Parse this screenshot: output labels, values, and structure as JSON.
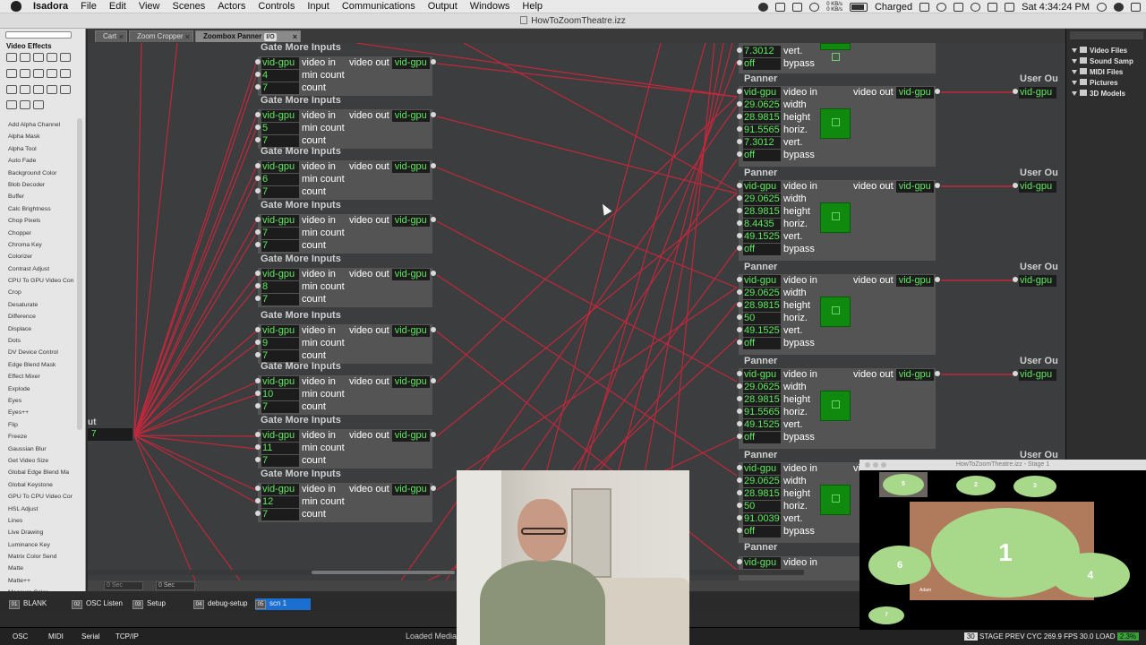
{
  "menubar": {
    "app": "Isadora",
    "items": [
      "File",
      "Edit",
      "View",
      "Scenes",
      "Actors",
      "Controls",
      "Input",
      "Communications",
      "Output",
      "Windows",
      "Help"
    ],
    "battery": "Charged",
    "clock": "Sat 4:34:24 PM",
    "net_up": "0 KB/s",
    "net_down": "0 KB/s"
  },
  "window": {
    "title": "HowToZoomTheatre.izz"
  },
  "left_panel": {
    "title": "Video Effects",
    "items": [
      "Add Alpha Channel",
      "Alpha Mask",
      "Alpha Tool",
      "Auto Fade",
      "Background Color",
      "Blob Decoder",
      "Buffer",
      "Calc Brightness",
      "Chop Pixels",
      "Chopper",
      "Chroma Key",
      "Colorizer",
      "Contrast Adjust",
      "CPU To GPU Video Con",
      "Crop",
      "Desaturate",
      "Difference",
      "Displace",
      "Dots",
      "DV Device Control",
      "Edge Blend Mask",
      "Effect Mixer",
      "Explode",
      "Eyes",
      "Eyes++",
      "Flip",
      "Freeze",
      "Gaussian Blur",
      "Get Video Size",
      "Global Edge Blend Ma",
      "Global Keystone",
      "GPU To CPU Video Cor",
      "HSL Adjust",
      "Lines",
      "Live Drawing",
      "Luminance Key",
      "Matrix Color Send",
      "Matte",
      "Matte++",
      "Measure Color"
    ]
  },
  "tabs": [
    {
      "label": "Cart",
      "active": false
    },
    {
      "label": "Zoom Cropper",
      "active": false
    },
    {
      "label": "Zoombox Panner",
      "active": true,
      "badge": "I/O"
    }
  ],
  "gates": [
    {
      "title": "Gate More Inputs",
      "input": "vid-gpu",
      "min_count": "4",
      "count": "7",
      "label_in": "video in",
      "label_out": "video out",
      "output": "vid-gpu",
      "label_min": "min count",
      "label_count": "count"
    },
    {
      "title": "Gate More Inputs",
      "input": "vid-gpu",
      "min_count": "5",
      "count": "7",
      "label_in": "video in",
      "label_out": "video out",
      "output": "vid-gpu",
      "label_min": "min count",
      "label_count": "count"
    },
    {
      "title": "Gate More Inputs",
      "input": "vid-gpu",
      "min_count": "6",
      "count": "7",
      "label_in": "video in",
      "label_out": "video out",
      "output": "vid-gpu",
      "label_min": "min count",
      "label_count": "count"
    },
    {
      "title": "Gate More Inputs",
      "input": "vid-gpu",
      "min_count": "7",
      "count": "7",
      "label_in": "video in",
      "label_out": "video out",
      "output": "vid-gpu",
      "label_min": "min count",
      "label_count": "count"
    },
    {
      "title": "Gate More Inputs",
      "input": "vid-gpu",
      "min_count": "8",
      "count": "7",
      "label_in": "video in",
      "label_out": "video out",
      "output": "vid-gpu",
      "label_min": "min count",
      "label_count": "count"
    },
    {
      "title": "Gate More Inputs",
      "input": "vid-gpu",
      "min_count": "9",
      "count": "7",
      "label_in": "video in",
      "label_out": "video out",
      "output": "vid-gpu",
      "label_min": "min count",
      "label_count": "count"
    },
    {
      "title": "Gate More Inputs",
      "input": "vid-gpu",
      "min_count": "10",
      "count": "7",
      "label_in": "video in",
      "label_out": "video out",
      "output": "vid-gpu",
      "label_min": "min count",
      "label_count": "count"
    },
    {
      "title": "Gate More Inputs",
      "input": "vid-gpu",
      "min_count": "11",
      "count": "7",
      "label_in": "video in",
      "label_out": "video out",
      "output": "vid-gpu",
      "label_min": "min count",
      "label_count": "count"
    },
    {
      "title": "Gate More Inputs",
      "input": "vid-gpu",
      "min_count": "12",
      "count": "7",
      "label_in": "video in",
      "label_out": "video out",
      "output": "vid-gpu",
      "label_min": "min count",
      "label_count": "count"
    }
  ],
  "panner_top": {
    "vert": "7.3012",
    "bypass": "off",
    "label_vert": "vert.",
    "label_bypass": "bypass"
  },
  "panners": [
    {
      "title": "Panner",
      "input": "vid-gpu",
      "width": "29.0625",
      "height": "28.9815",
      "horiz": "91.5565",
      "vert": "7.3012",
      "bypass": "off",
      "output": "vid-gpu",
      "user_out": "User Ou",
      "user_val": "vid-gpu"
    },
    {
      "title": "Panner",
      "input": "vid-gpu",
      "width": "29.0625",
      "height": "28.9815",
      "horiz": "8.4435",
      "vert": "49.1525",
      "bypass": "off",
      "output": "vid-gpu",
      "user_out": "User Ou",
      "user_val": "vid-gpu"
    },
    {
      "title": "Panner",
      "input": "vid-gpu",
      "width": "29.0625",
      "height": "28.9815",
      "horiz": "50",
      "vert": "49.1525",
      "bypass": "off",
      "output": "vid-gpu",
      "user_out": "User Ou",
      "user_val": "vid-gpu"
    },
    {
      "title": "Panner",
      "input": "vid-gpu",
      "width": "29.0625",
      "height": "28.9815",
      "horiz": "91.5565",
      "vert": "49.1525",
      "bypass": "off",
      "output": "vid-gpu",
      "user_out": "User Ou",
      "user_val": "vid-gpu"
    },
    {
      "title": "Panner",
      "input": "vid-gpu",
      "width": "29.0625",
      "height": "28.9815",
      "horiz": "50",
      "vert": "91.0039",
      "bypass": "off",
      "output": "vid-gpu",
      "user_out": "User Ou",
      "user_val": "vid-gpu"
    }
  ],
  "panner_labels": {
    "video_in": "video in",
    "width": "width",
    "height": "height",
    "horiz": "horiz.",
    "vert": "vert.",
    "bypass": "bypass",
    "video_out": "video out"
  },
  "panner_last": {
    "title": "Panner",
    "input": "vid-gpu",
    "label": "video in"
  },
  "left_actor": {
    "label": "ut",
    "value": "7"
  },
  "right_panel": {
    "items": [
      "Video Files",
      "Sound Samp",
      "MIDI Files",
      "Pictures",
      "3D Models"
    ]
  },
  "timeline": {
    "left": "0 Sec",
    "right": "0 Sec"
  },
  "scenes": [
    {
      "num": "01",
      "label": "BLANK",
      "active": false
    },
    {
      "num": "02",
      "label": "OSC Listen",
      "active": false
    },
    {
      "num": "03",
      "label": "Setup",
      "active": false
    },
    {
      "num": "04",
      "label": "debug-setup",
      "active": false
    },
    {
      "num": "05",
      "label": "scn 1",
      "active": true
    }
  ],
  "status": {
    "items": [
      "OSC",
      "MIDI",
      "Serial",
      "TCP/IP"
    ],
    "loaded": "Loaded Media",
    "stage_prev": "STAGE PREV",
    "frame_rate": "30",
    "cyc": "CYC 269.9",
    "fps": "FPS 30.0",
    "load_label": "LOAD",
    "load": "2.3%"
  },
  "stage": {
    "title": "HowToZoomTheatre.izz - Stage 1",
    "labels": [
      "5",
      "2",
      "3",
      "1",
      "6",
      "4",
      "7"
    ],
    "caption": "Adam"
  },
  "colors": {
    "wire": "#c0283c",
    "value_text": "#5ee85e",
    "preview_green": "#0f8a0f",
    "stage_oval": "#a8d889"
  }
}
